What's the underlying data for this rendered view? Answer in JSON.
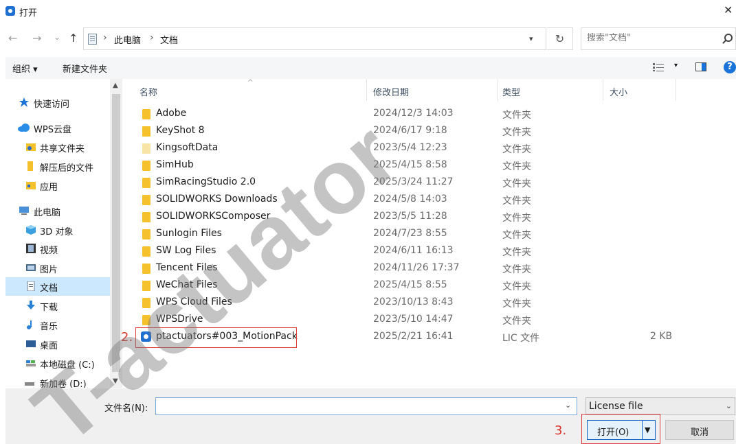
{
  "window": {
    "title": "打开",
    "close_glyph": "✕"
  },
  "nav": {
    "back": "←",
    "forward": "→",
    "history": "⌄",
    "up": "↑",
    "breadcrumbs": [
      "此电脑",
      "文档"
    ],
    "separator": "›",
    "refresh": "↻",
    "search_placeholder": "搜索\"文档\""
  },
  "toolbar": {
    "organize": "组织 ▾",
    "new_folder": "新建文件夹"
  },
  "sidebar": {
    "items": [
      {
        "label": "快速访问",
        "icon": "star-icon"
      },
      {
        "label": "WPS云盘",
        "icon": "cloud-icon"
      },
      {
        "label": "共享文件夹",
        "icon": "shared-folder-icon"
      },
      {
        "label": "解压后的文件",
        "icon": "folder-icon"
      },
      {
        "label": "应用",
        "icon": "apps-folder-icon"
      },
      {
        "label": "此电脑",
        "icon": "computer-icon"
      },
      {
        "label": "3D 对象",
        "icon": "3d-objects-icon"
      },
      {
        "label": "视频",
        "icon": "video-icon"
      },
      {
        "label": "图片",
        "icon": "picture-icon"
      },
      {
        "label": "文档",
        "icon": "document-icon"
      },
      {
        "label": "下载",
        "icon": "download-icon"
      },
      {
        "label": "音乐",
        "icon": "music-icon"
      },
      {
        "label": "桌面",
        "icon": "desktop-icon"
      },
      {
        "label": "本地磁盘 (C:)",
        "icon": "drive-icon"
      },
      {
        "label": "新加卷 (D:)",
        "icon": "drive-icon"
      }
    ],
    "selected": "文档"
  },
  "columns": {
    "name": "名称",
    "date": "修改日期",
    "type": "类型",
    "size": "大小"
  },
  "files": [
    {
      "name": "Adobe",
      "date": "2024/12/3 14:03",
      "type": "文件夹",
      "size": ""
    },
    {
      "name": "KeyShot 8",
      "date": "2024/6/17 9:18",
      "type": "文件夹",
      "size": ""
    },
    {
      "name": "KingsoftData",
      "date": "2023/5/4 12:23",
      "type": "文件夹",
      "size": ""
    },
    {
      "name": "SimHub",
      "date": "2025/4/15 8:58",
      "type": "文件夹",
      "size": ""
    },
    {
      "name": "SimRacingStudio 2.0",
      "date": "2025/3/24 11:27",
      "type": "文件夹",
      "size": ""
    },
    {
      "name": "SOLIDWORKS Downloads",
      "date": "2024/5/8 14:03",
      "type": "文件夹",
      "size": ""
    },
    {
      "name": "SOLIDWORKSComposer",
      "date": "2023/5/5 11:28",
      "type": "文件夹",
      "size": ""
    },
    {
      "name": "Sunlogin Files",
      "date": "2024/7/23 8:55",
      "type": "文件夹",
      "size": ""
    },
    {
      "name": "SW Log Files",
      "date": "2024/6/11 16:13",
      "type": "文件夹",
      "size": ""
    },
    {
      "name": "Tencent Files",
      "date": "2024/11/26 17:37",
      "type": "文件夹",
      "size": ""
    },
    {
      "name": "WeChat Files",
      "date": "2025/4/15 8:55",
      "type": "文件夹",
      "size": ""
    },
    {
      "name": "WPS Cloud Files",
      "date": "2023/10/13 8:43",
      "type": "文件夹",
      "size": ""
    },
    {
      "name": "WPSDrive",
      "date": "2023/5/10 14:47",
      "type": "文件夹",
      "size": ""
    },
    {
      "name": "ptactuators#003_MotionPack",
      "date": "2025/2/21 16:41",
      "type": "LIC 文件",
      "size": "2 KB"
    }
  ],
  "annotations": {
    "step2": "2.",
    "step3": "3."
  },
  "bottom": {
    "filename_label": "文件名(N):",
    "filename_value": "",
    "filetype": "License file",
    "open_label": "打开(O)",
    "cancel_label": "取消"
  },
  "watermark": "T-actuator",
  "colors": {
    "accent": "#1a73d8",
    "selection": "#cce8ff",
    "folder": "#f5c12c",
    "annotation_red": "#e03a3a"
  }
}
